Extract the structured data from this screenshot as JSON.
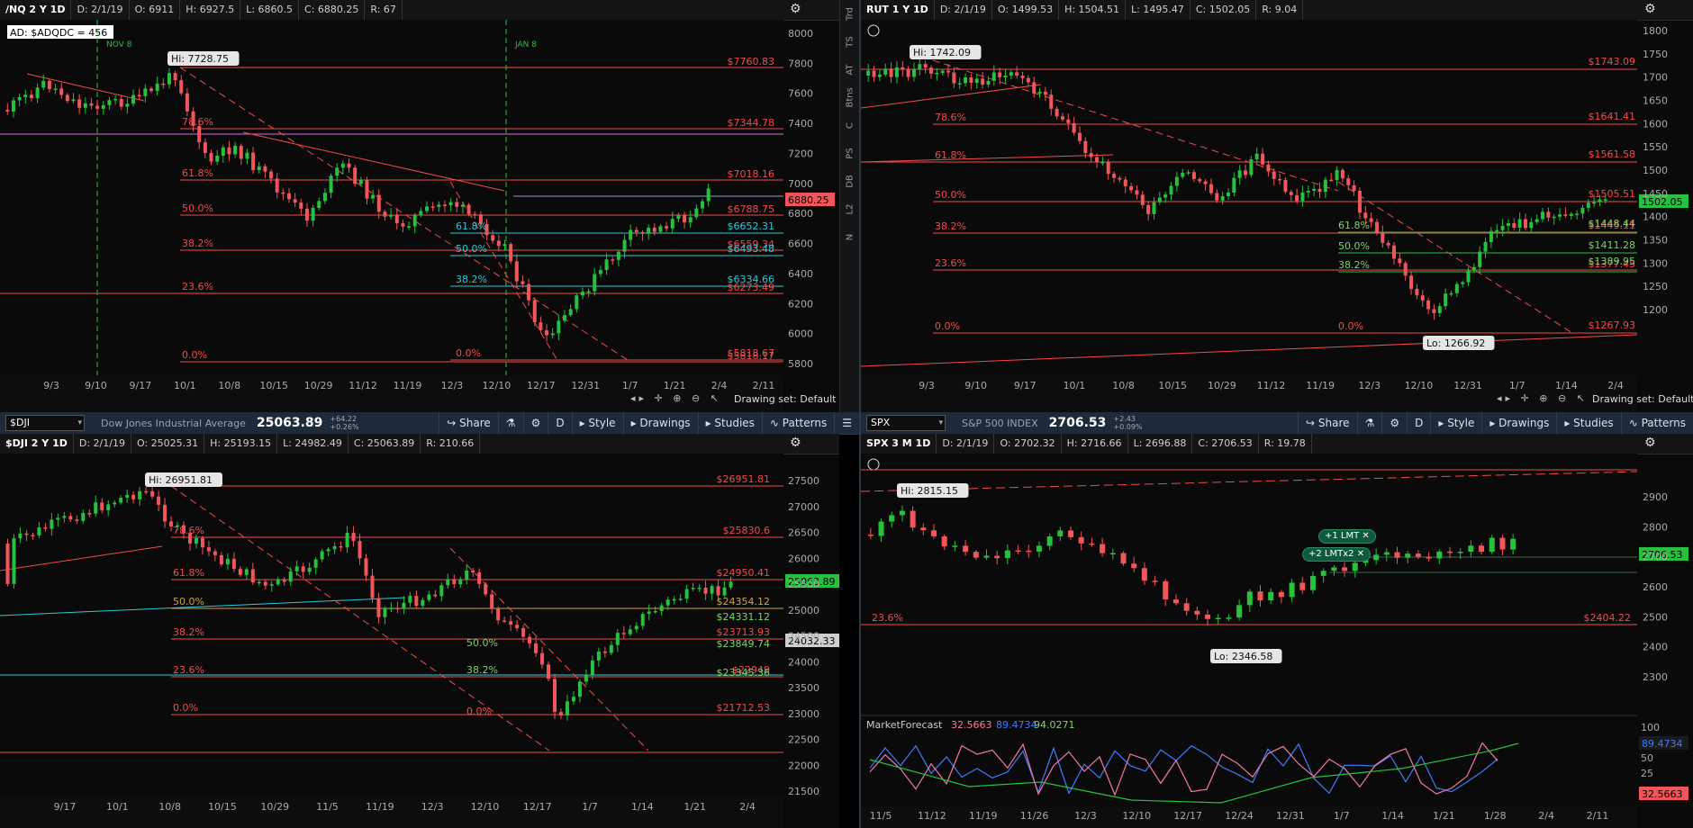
{
  "colors": {
    "up": "#27c03f",
    "down": "#f2555a",
    "bg": "#0a0a0a",
    "fib": "#f24b4b",
    "cyan": "#2fc8d8",
    "magenta": "#d66bd9",
    "hi": "#e9e9e9"
  },
  "panels": {
    "nq": {
      "info": {
        "symbol": "/NQ 2 Y 1D",
        "d": "D: 2/1/19",
        "o": "O: 6911",
        "h": "H: 6927.5",
        "l": "L: 6860.5",
        "c": "C: 6880.25",
        "r": "R: 67"
      },
      "ad_label": "AD: $ADQDC = 456",
      "hi_label": "Hi: 7728.75",
      "current_tag": "6880.25",
      "fib_left": [
        "78.6%",
        "61.8%",
        "50.0%",
        "38.2%",
        "23.6%",
        "0.0%"
      ],
      "fib_right": [
        "$7760.83",
        "$7344.78",
        "$7018.16",
        "$6788.75",
        "$6559.34",
        "$6273.49",
        "$5818.17"
      ],
      "fib2_left": [
        "61.8%",
        "50.0%",
        "38.2%",
        "0.0%"
      ],
      "fib2_right": [
        "$6652.31",
        "$6493.48",
        "$6334.66",
        "$5818.67"
      ],
      "yaxis": [
        "8000",
        "7800",
        "7600",
        "7400",
        "7200",
        "7000",
        "6800",
        "6600",
        "6400",
        "6200",
        "6000",
        "5800"
      ],
      "xaxis": [
        "9/3",
        "9/10",
        "9/17",
        "10/1",
        "10/8",
        "10/15",
        "10/29",
        "11/12",
        "11/19",
        "12/3",
        "12/10",
        "12/17",
        "12/31",
        "1/7",
        "1/21",
        "2/4",
        "2/11"
      ],
      "vmarks": [
        "NOV 8",
        "JAN 8"
      ],
      "drawing_set": "Drawing set: Default"
    },
    "rut": {
      "info": {
        "symbol": "RUT 1 Y 1D",
        "d": "D: 2/1/19",
        "o": "O: 1499.53",
        "h": "H: 1504.51",
        "l": "L: 1495.47",
        "c": "C: 1502.05",
        "r": "R: 9.04"
      },
      "hi_label": "Hi: 1742.09",
      "lo_label": "Lo: 1266.92",
      "current_tag": "1502.05",
      "fib_left": [
        "78.6%",
        "61.8%",
        "50.0%",
        "38.2%",
        "23.6%",
        "0.0%"
      ],
      "fib_right": [
        "$1743.09",
        "$1641.41",
        "$1561.58",
        "$1505.51",
        "$1445.11",
        "$1411.28",
        "$1377.45",
        "$1267.93"
      ],
      "fib2_left": [
        "61.8%",
        "50.0%",
        "38.2%",
        "0.0%"
      ],
      "fib2_right": [
        "$1448.44",
        "$1389.95"
      ],
      "yaxis": [
        "1800",
        "1750",
        "1700",
        "1650",
        "1600",
        "1550",
        "1500",
        "1450",
        "1400",
        "1350",
        "1300",
        "1250",
        "1200"
      ],
      "xaxis": [
        "9/3",
        "9/10",
        "9/17",
        "10/1",
        "10/8",
        "10/15",
        "10/29",
        "11/12",
        "11/19",
        "12/3",
        "12/10",
        "12/31",
        "1/7",
        "1/14",
        "2/4"
      ],
      "drawing_set": "Drawing set: Default"
    },
    "dji": {
      "toolbar": {
        "symbol": "$DJI",
        "desc": "Dow Jones Industrial Average",
        "price": "25063.89",
        "chg1": "+64.22",
        "chg2": "+0.26%",
        "share": "Share",
        "period": "D",
        "style": "Style",
        "drawings": "Drawings",
        "studies": "Studies",
        "patterns": "Patterns"
      },
      "info": {
        "symbol": "$DJI 2 Y 1D",
        "d": "D: 2/1/19",
        "o": "O: 25025.31",
        "h": "H: 25193.15",
        "l": "L: 24982.49",
        "c": "C: 25063.89",
        "r": "R: 210.66"
      },
      "hi_label": "Hi: 26951.81",
      "current_tag": "25063.89",
      "gray_tag": "24032.33",
      "fib_left": [
        "78.6%",
        "61.8%",
        "50.0%",
        "38.2%",
        "23.6%",
        "0.0%"
      ],
      "fib_right": [
        "$26951.81",
        "$25830.6",
        "$24950.41",
        "$24354.12",
        "$23713.93",
        "$22949",
        "$21712.53"
      ],
      "fib2_left": [
        "50.0%",
        "38.2%",
        "0.0%"
      ],
      "fib2_right": [
        "$24331.12",
        "$23849.74",
        "$23345.36"
      ],
      "yaxis": [
        "27500",
        "27000",
        "26500",
        "26000",
        "25500",
        "25000",
        "24500",
        "24000",
        "23500",
        "23000",
        "22500",
        "22000",
        "21500"
      ],
      "xaxis": [
        "9/17",
        "10/1",
        "10/8",
        "10/15",
        "10/29",
        "11/5",
        "11/19",
        "12/3",
        "12/10",
        "12/17",
        "1/7",
        "1/14",
        "1/21",
        "2/4"
      ]
    },
    "spx": {
      "toolbar": {
        "symbol": "SPX",
        "desc": "S&P 500 INDEX",
        "price": "2706.53",
        "chg1": "+2.43",
        "chg2": "+0.09%",
        "share": "Share",
        "period": "D",
        "style": "Style",
        "drawings": "Drawings",
        "studies": "Studies",
        "patterns": "Patterns"
      },
      "info": {
        "symbol": "SPX 3 M 1D",
        "d": "D: 2/1/19",
        "o": "O: 2702.32",
        "h": "H: 2716.66",
        "l": "L: 2696.88",
        "c": "C: 2706.53",
        "r": "R: 19.78"
      },
      "hi_label": "Hi: 2815.15",
      "lo_label": "Lo: 2346.58",
      "current_tag": "2706.53",
      "order1": "+1 LMT",
      "order2": "+2 LMTx2",
      "fib_left": [
        "23.6%"
      ],
      "fib_right": [
        "$2404.22"
      ],
      "yaxis": [
        "2900",
        "2800",
        "2700",
        "2600",
        "2500",
        "2400",
        "2300"
      ],
      "xaxis": [
        "11/5",
        "11/12",
        "11/19",
        "11/26",
        "12/3",
        "12/10",
        "12/17",
        "12/24",
        "12/31",
        "1/7",
        "1/14",
        "1/21",
        "1/28",
        "2/4",
        "2/11"
      ],
      "mf": {
        "title": "MarketForecast",
        "v1": "32.5663",
        "v2": "89.4734",
        "v3": "94.0271",
        "axis": [
          "100",
          "75",
          "50",
          "25"
        ],
        "tag_hi": "89.4734",
        "tag_lo": "32.5663"
      }
    }
  },
  "sidebar_tabs": [
    "Trd",
    "TS",
    "AT",
    "Btns",
    "C",
    "PS",
    "DB",
    "L2",
    "N"
  ]
}
